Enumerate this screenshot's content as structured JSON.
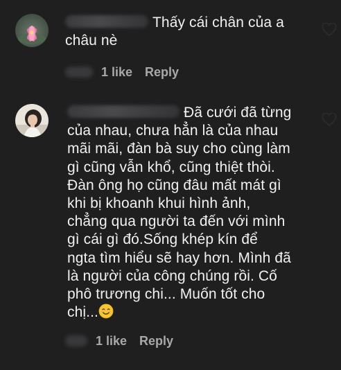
{
  "comments": [
    {
      "username_hidden": true,
      "text": "Thấy cái chân của a\nchâu nè",
      "likes_label": "1 like",
      "reply_label": "Reply",
      "avatar_icon": "lotus-flower-avatar"
    },
    {
      "username_hidden": true,
      "text_lines": [
        "Đã cưới đã từng",
        "của nhau, chưa hẳn là của nhau",
        "mãi mãi, đàn bà suy cho cùng làm",
        "gì cũng vẫn khổ, cũng thiệt thòi.",
        "Đàn ông họ cũng đâu mất mát gì",
        "khi bị khoanh khui hình ảnh,",
        "chẳng qua người ta đến với mình",
        "gì cái gì đó.Sống khép kín để",
        "ngta tìm hiểu sẽ hay hơn. Mình đã",
        "là người của công chúng rồi. Cố",
        "phô trương chi... Muốn tốt cho",
        "chị..."
      ],
      "emoji": "smiling-face-emoji",
      "likes_label": "1 like",
      "reply_label": "Reply",
      "avatar_icon": "woman-portrait-avatar"
    }
  ],
  "colors": {
    "background": "#1f1f20",
    "text": "#f1f1f1",
    "meta": "#a9a9ab",
    "heart_outline": "#2b2b2d"
  }
}
